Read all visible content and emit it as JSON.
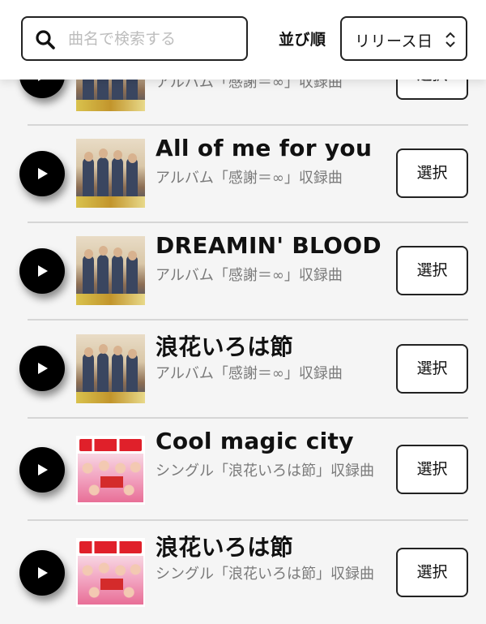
{
  "search": {
    "placeholder": "曲名で検索する",
    "value": ""
  },
  "sort": {
    "label": "並び順",
    "value": "リリース日"
  },
  "songs": [
    {
      "title": "",
      "subtitle": "アルバム「感謝＝∞」収録曲",
      "select_label": "選択",
      "art": "kanshai"
    },
    {
      "title": "All of me for you",
      "subtitle": "アルバム「感謝＝∞」収録曲",
      "select_label": "選択",
      "art": "kanshai"
    },
    {
      "title": "DREAMIN' BLOOD",
      "subtitle": "アルバム「感謝＝∞」収録曲",
      "select_label": "選択",
      "art": "kanshai"
    },
    {
      "title": "浪花いろは節",
      "subtitle": "アルバム「感謝＝∞」収録曲",
      "select_label": "選択",
      "art": "kanshai"
    },
    {
      "title": "Cool magic city",
      "subtitle": "シングル「浪花いろは節」収録曲",
      "select_label": "選択",
      "art": "namba"
    },
    {
      "title": "浪花いろは節",
      "subtitle": "シングル「浪花いろは節」収録曲",
      "select_label": "選択",
      "art": "namba"
    }
  ]
}
